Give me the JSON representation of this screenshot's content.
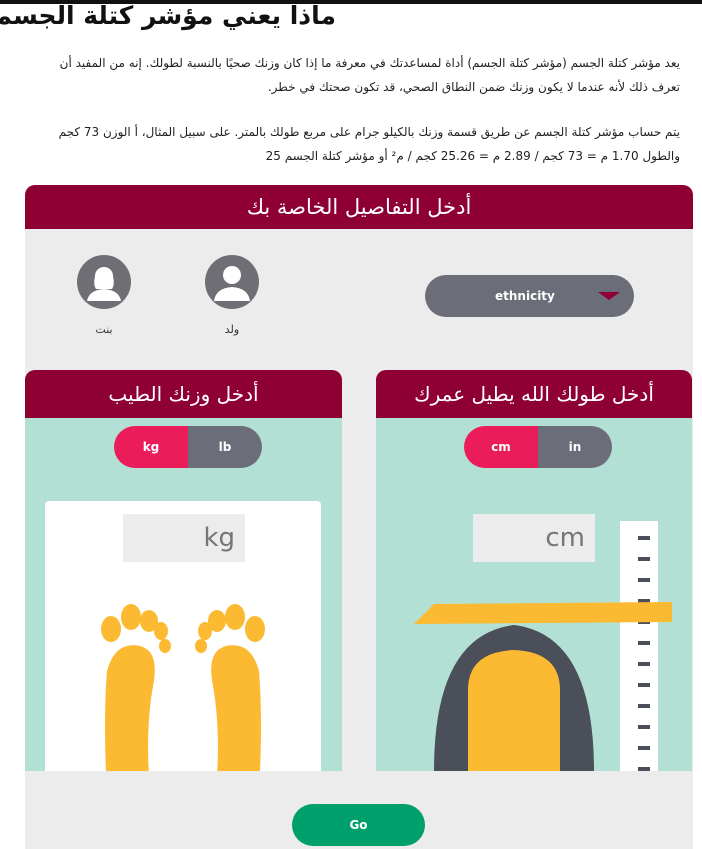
{
  "page": {
    "title": "ماذا يعني مؤشر كتلة الجسم؟",
    "paragraph1": "يعد مؤشر كتلة الجسم (مؤشر كتلة الجسم) أداة لمساعدتك في معرفة ما إذا كان وزنك صحيًا بالنسبة لطولك. إنه من المفيد أن تعرف ذلك لأنه عندما لا يكون وزنك ضمن النطاق الصحي، قد تكون صحتك في خطر.",
    "paragraph2": "يتم حساب مؤشر كتلة الجسم عن طريق قسمة وزنك بالكيلو جرام على مربع طولك بالمتر. على سبيل المثال، أ الوزن 73 كجم والطول 1.70 م = 73 كجم / 2.89 م = 25.26 كجم / م² أو مؤشر كتلة الجسم 25"
  },
  "details": {
    "header": "أدخل التفاصيل الخاصة بك",
    "gender_boy": "ولد",
    "gender_girl": "بنت",
    "ethnicity": "ethnicity"
  },
  "weight": {
    "header": "أدخل وزنك الطيب",
    "unit_kg": "kg",
    "unit_lb": "lb",
    "input_unit": "kg"
  },
  "height": {
    "header": "أدخل طولك الله يطيل عمرك",
    "unit_cm": "cm",
    "unit_in": "in",
    "input_unit": "cm"
  },
  "actions": {
    "go": "Go"
  },
  "colors": {
    "header": "#8e0033",
    "toggle_active": "#ea1d5a",
    "toggle_inactive": "#6b6e78",
    "panel": "#b3e0d4",
    "go": "#00a06c",
    "foot": "#fbba31"
  }
}
